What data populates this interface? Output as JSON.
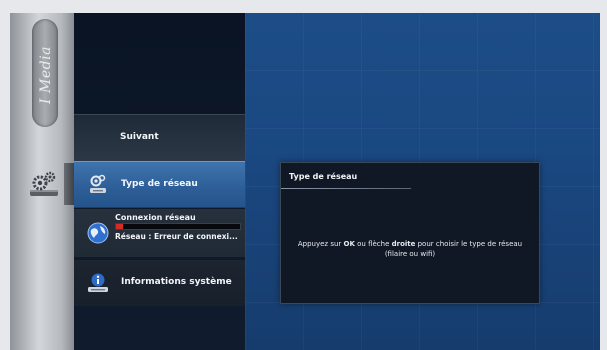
{
  "brand": {
    "label": "I Media"
  },
  "menu": {
    "next_label": "Suivant",
    "network_type_label": "Type de réseau",
    "network_connection": {
      "label": "Connexion réseau",
      "progress": 0.06,
      "status": "Réseau : Erreur de connexi..."
    },
    "system_info_label": "Informations système"
  },
  "panel": {
    "title": "Type de réseau",
    "body_prefix": "Appuyez sur ",
    "body_ok": "OK",
    "body_middle": " ou flèche ",
    "body_right": "droite",
    "body_suffix": " pour choisir le type de réseau (filaire ou wifi)"
  },
  "colors": {
    "background_blue": "#1a4780",
    "menu_dark": "#0a1424",
    "selected_row": "#2e5f98",
    "progress_red": "#d82b26"
  },
  "icons": [
    "settings-icon",
    "network-type-icon",
    "globe-icon",
    "system-info-icon"
  ]
}
